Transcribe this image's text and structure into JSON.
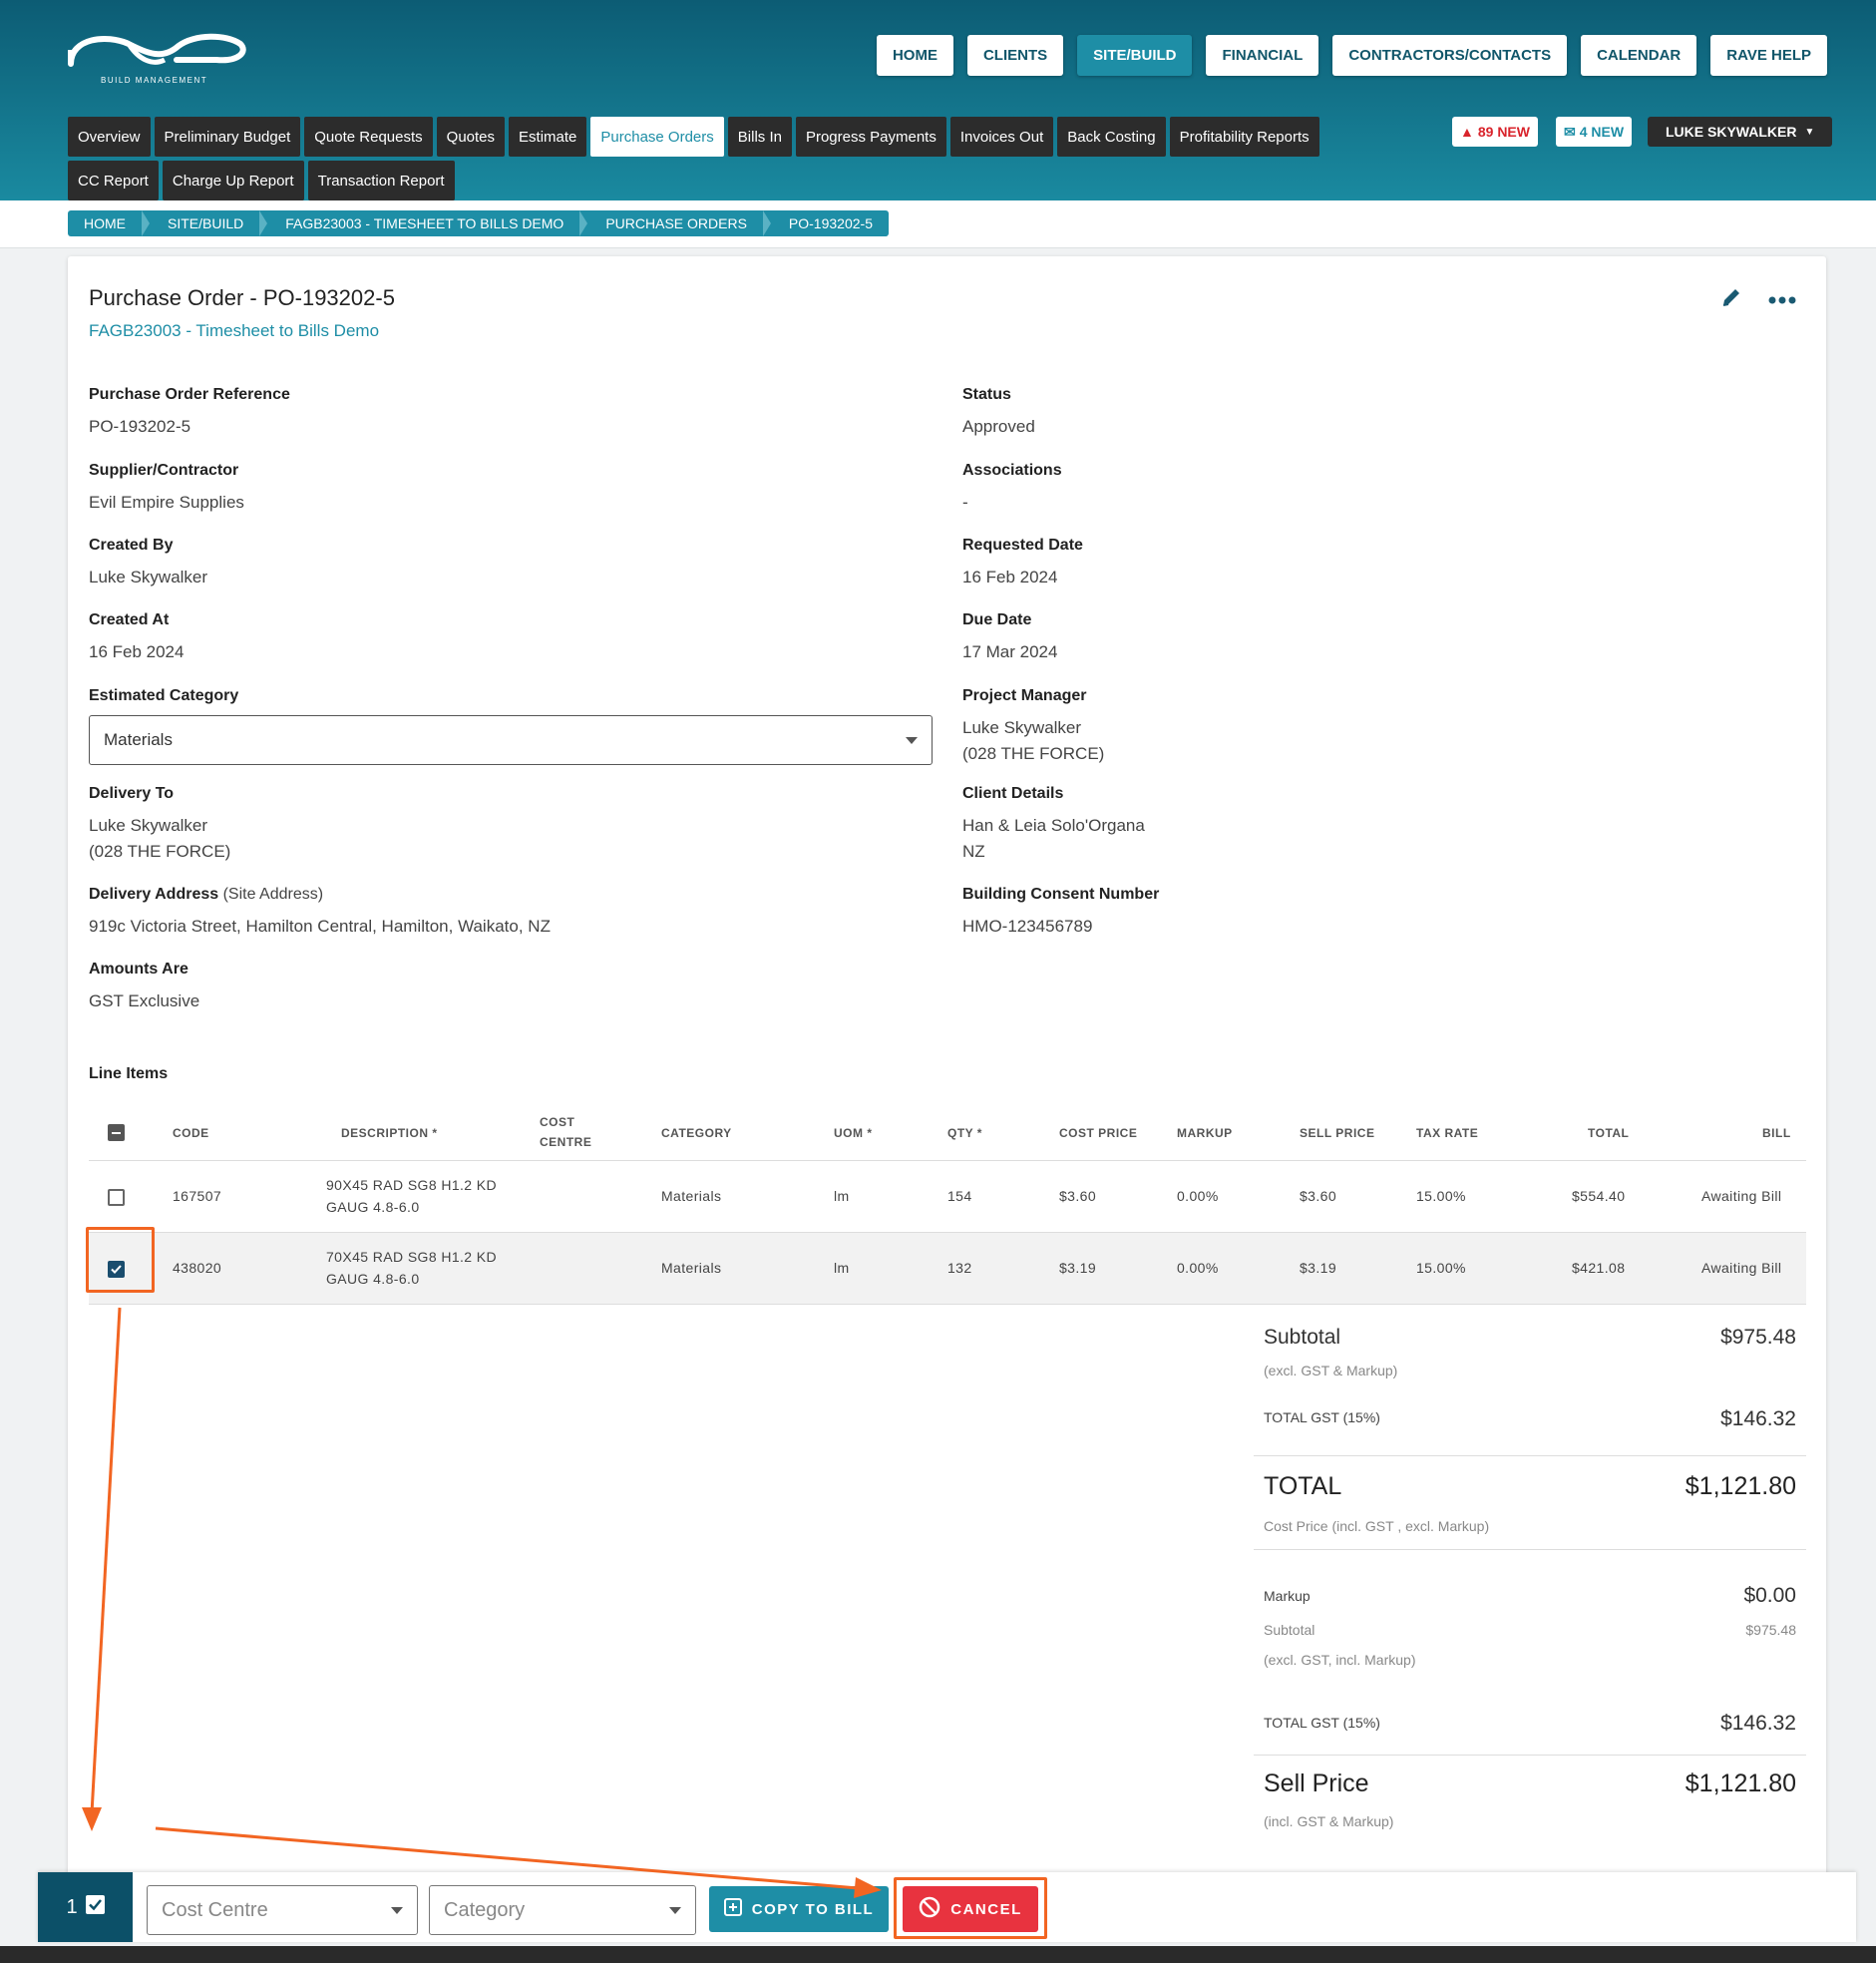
{
  "brand": {
    "logo_text": "rave",
    "logo_sub": "BUILD MANAGEMENT"
  },
  "top_nav": [
    {
      "label": "HOME"
    },
    {
      "label": "CLIENTS"
    },
    {
      "label": "SITE/BUILD",
      "active": true
    },
    {
      "label": "FINANCIAL"
    },
    {
      "label": "CONTRACTORS/CONTACTS"
    },
    {
      "label": "CALENDAR"
    },
    {
      "label": "RAVE HELP"
    }
  ],
  "sub_nav": [
    {
      "label": "Overview"
    },
    {
      "label": "Preliminary Budget"
    },
    {
      "label": "Quote Requests"
    },
    {
      "label": "Quotes"
    },
    {
      "label": "Estimate"
    },
    {
      "label": "Purchase Orders",
      "active": true
    },
    {
      "label": "Bills In"
    },
    {
      "label": "Progress Payments"
    },
    {
      "label": "Invoices Out"
    },
    {
      "label": "Back Costing"
    },
    {
      "label": "Profitability Reports"
    },
    {
      "label": "CC Report"
    },
    {
      "label": "Charge Up Report"
    },
    {
      "label": "Transaction Report"
    }
  ],
  "badges": {
    "alerts": "89 NEW",
    "messages": "4 NEW"
  },
  "user": {
    "name": "LUKE SKYWALKER"
  },
  "breadcrumb": [
    "HOME",
    "SITE/BUILD",
    "FAGB23003 - TIMESHEET TO BILLS DEMO",
    "PURCHASE ORDERS",
    "PO-193202-5"
  ],
  "po": {
    "title": "Purchase Order - PO-193202-5",
    "job_link": "FAGB23003 - Timesheet to Bills Demo",
    "left_fields": [
      {
        "label": "Purchase Order Reference",
        "value": "PO-193202-5"
      },
      {
        "label": "Supplier/Contractor",
        "value": "Evil Empire Supplies"
      },
      {
        "label": "Created By",
        "value": "Luke Skywalker"
      },
      {
        "label": "Created At",
        "value": "16 Feb 2024"
      },
      {
        "label": "Estimated Category",
        "value": ""
      },
      {
        "label": "Delivery To",
        "value": "Luke Skywalker",
        "value2": "(028 THE FORCE)"
      },
      {
        "label": "Delivery Address",
        "label_suffix": "(Site Address)",
        "value": "919c Victoria Street, Hamilton Central, Hamilton, Waikato, NZ"
      },
      {
        "label": "Amounts Are",
        "value": "GST Exclusive"
      }
    ],
    "estimated_category_value": "Materials",
    "right_fields": [
      {
        "label": "Status",
        "value": "Approved"
      },
      {
        "label": "Associations",
        "value": "-"
      },
      {
        "label": "Requested Date",
        "value": "16 Feb 2024"
      },
      {
        "label": "Due Date",
        "value": "17 Mar 2024"
      },
      {
        "label": "Project Manager",
        "value": "Luke Skywalker",
        "value2": "(028 THE FORCE)"
      },
      {
        "label": "Client Details",
        "value": "Han & Leia Solo'Organa",
        "value2": "NZ"
      },
      {
        "label": "Building Consent Number",
        "value": "HMO-123456789"
      }
    ]
  },
  "line_items": {
    "heading": "Line Items",
    "columns": {
      "code": "CODE",
      "description": "DESCRIPTION *",
      "cost_centre_1": "COST",
      "cost_centre_2": "CENTRE",
      "category": "CATEGORY",
      "uom": "UOM *",
      "qty": "QTY *",
      "cost_price": "COST PRICE",
      "markup": "MARKUP",
      "sell_price": "SELL PRICE",
      "tax_rate": "TAX RATE",
      "total": "TOTAL",
      "bill": "BILL"
    },
    "rows": [
      {
        "checked": false,
        "code": "167507",
        "desc1": "90X45 RAD SG8 H1.2 KD",
        "desc2": "GAUG 4.8-6.0",
        "category": "Materials",
        "uom": "lm",
        "qty": "154",
        "cost_price": "$3.60",
        "markup": "0.00%",
        "sell_price": "$3.60",
        "tax_rate": "15.00%",
        "total": "$554.40",
        "bill": "Awaiting Bill"
      },
      {
        "checked": true,
        "code": "438020",
        "desc1": "70X45 RAD SG8 H1.2 KD",
        "desc2": "GAUG 4.8-6.0",
        "category": "Materials",
        "uom": "lm",
        "qty": "132",
        "cost_price": "$3.19",
        "markup": "0.00%",
        "sell_price": "$3.19",
        "tax_rate": "15.00%",
        "total": "$421.08",
        "bill": "Awaiting Bill"
      }
    ]
  },
  "totals": {
    "subtotal_label": "Subtotal",
    "subtotal_note": "(excl. GST & Markup)",
    "subtotal_value": "$975.48",
    "gst_label": "TOTAL GST (15%)",
    "gst_value": "$146.32",
    "total_label": "TOTAL",
    "total_note": "Cost Price (incl. GST , excl. Markup)",
    "total_value": "$1,121.80",
    "markup_label": "Markup",
    "markup_value": "$0.00",
    "markup_subtotal_label": "Subtotal",
    "markup_subtotal_value": "$975.48",
    "markup_subtotal_note": "(excl. GST, incl. Markup)",
    "gst2_label": "TOTAL GST (15%)",
    "gst2_value": "$146.32",
    "sell_label": "Sell Price",
    "sell_note": "(incl. GST & Markup)",
    "sell_value": "$1,121.80"
  },
  "bulk_bar": {
    "selected_count": "1",
    "cost_centre_placeholder": "Cost Centre",
    "category_placeholder": "Category",
    "copy_label": "COPY TO BILL",
    "cancel_label": "CANCEL"
  },
  "colors": {
    "accent": "#1e8ea6",
    "annotation": "#f26522",
    "danger": "#e8333f"
  }
}
